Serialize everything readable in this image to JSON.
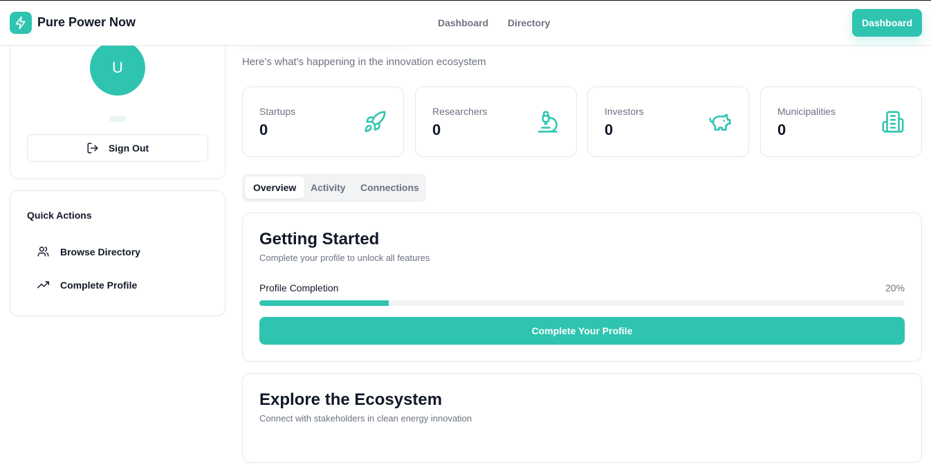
{
  "header": {
    "brand": "Pure Power Now",
    "nav": {
      "dashboard": "Dashboard",
      "directory": "Directory"
    },
    "cta": "Dashboard"
  },
  "colors": {
    "accent": "#2ec4b0",
    "text": "#111827",
    "muted": "#6b7280",
    "border": "#e5e7eb"
  },
  "sidebar": {
    "avatar_initial": "U",
    "sign_out": "Sign Out",
    "quick_actions": {
      "title": "Quick Actions",
      "items": [
        {
          "label": "Browse Directory",
          "icon": "users-icon"
        },
        {
          "label": "Complete Profile",
          "icon": "trending-up-icon"
        }
      ]
    }
  },
  "main": {
    "subtitle": "Here's what's happening in the innovation ecosystem",
    "stats": [
      {
        "label": "Startups",
        "value": "0",
        "icon": "rocket-icon"
      },
      {
        "label": "Researchers",
        "value": "0",
        "icon": "microscope-icon"
      },
      {
        "label": "Investors",
        "value": "0",
        "icon": "piggy-bank-icon"
      },
      {
        "label": "Municipalities",
        "value": "0",
        "icon": "building-icon"
      }
    ],
    "tabs": [
      {
        "label": "Overview",
        "active": true
      },
      {
        "label": "Activity",
        "active": false
      },
      {
        "label": "Connections",
        "active": false
      }
    ],
    "getting_started": {
      "title": "Getting Started",
      "subtitle": "Complete your profile to unlock all features",
      "progress_label": "Profile Completion",
      "progress_text": "20%",
      "progress_value": 0.2,
      "button": "Complete Your Profile"
    },
    "explore": {
      "title": "Explore the Ecosystem",
      "subtitle": "Connect with stakeholders in clean energy innovation"
    }
  }
}
